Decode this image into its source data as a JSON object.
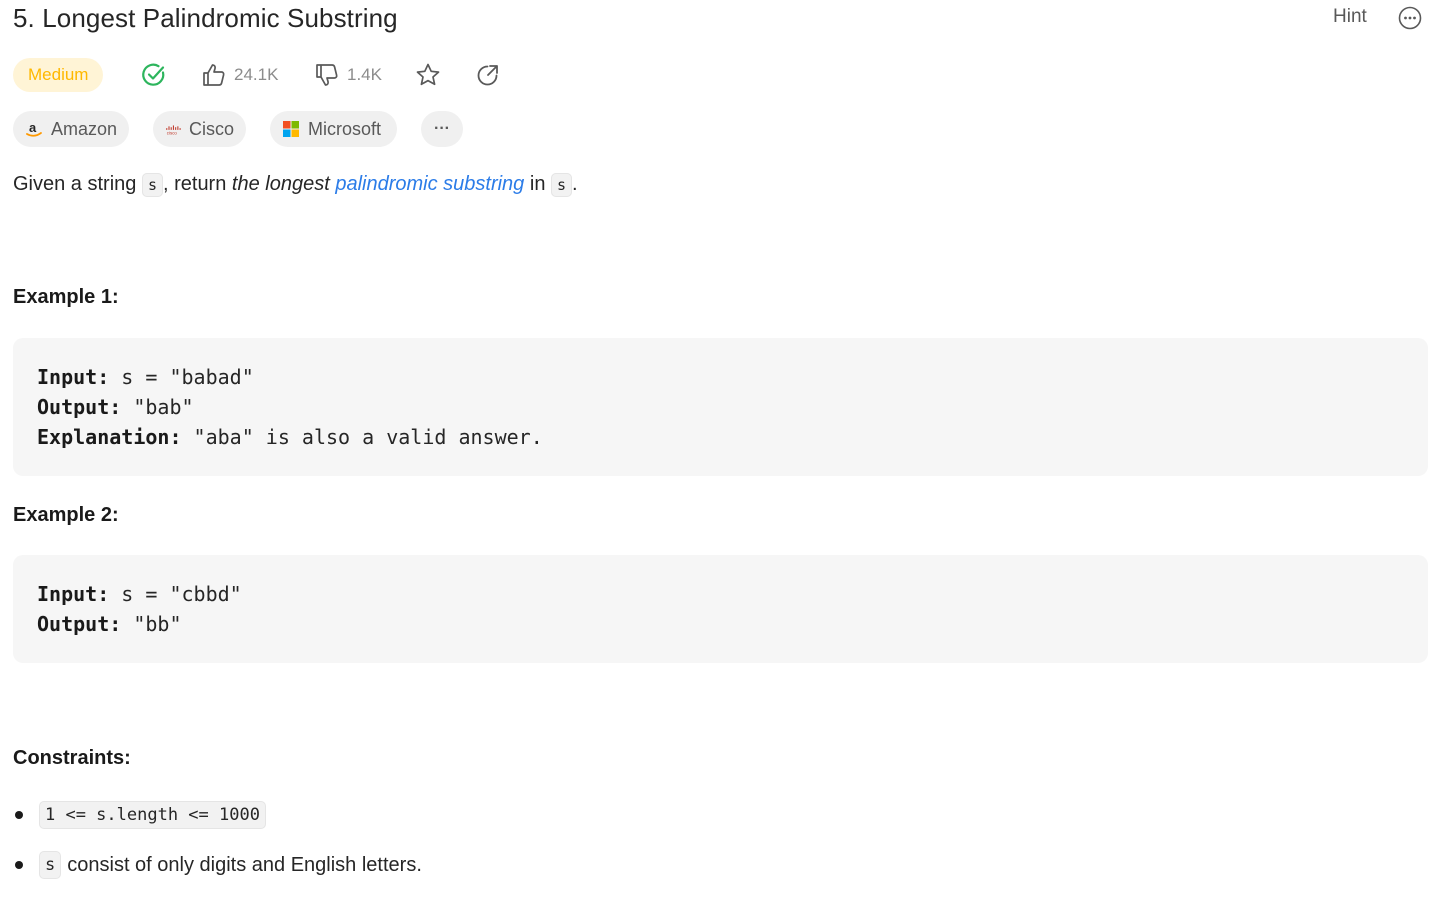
{
  "problem": {
    "title": "5. Longest Palindromic Substring",
    "hint_label": "Hint",
    "difficulty": "Medium",
    "likes": "24.1K",
    "dislikes": "1.4K",
    "colors": {
      "medium_text": "#ffb800",
      "medium_bg": "#fff4d6",
      "solved": "#2db55d",
      "link": "#2b7ce8"
    }
  },
  "tags": [
    {
      "label": "Amazon",
      "icon": "amazon-logo"
    },
    {
      "label": "Cisco",
      "icon": "cisco-logo"
    },
    {
      "label": "Microsoft",
      "icon": "microsoft-logo"
    },
    {
      "label": "···",
      "icon": "more-icon"
    }
  ],
  "description": {
    "part1": "Given a string ",
    "code1": "s",
    "part2": ", return ",
    "italic": "the longest",
    "link": "palindromic substring",
    "part3": " in ",
    "code2": "s",
    "part4": "."
  },
  "examples": [
    {
      "heading": "Example 1:",
      "input_key": "Input:",
      "input_val": " s = \"babad\"",
      "output_key": "Output:",
      "output_val": " \"bab\"",
      "explanation_key": "Explanation:",
      "explanation_val": " \"aba\" is also a valid answer."
    },
    {
      "heading": "Example 2:",
      "input_key": "Input:",
      "input_val": " s = \"cbbd\"",
      "output_key": "Output:",
      "output_val": " \"bb\""
    }
  ],
  "constraints": {
    "heading": "Constraints:",
    "items": [
      {
        "code": "1 <= s.length <= 1000",
        "text": ""
      },
      {
        "code": "s",
        "text": "consist of only digits and English letters."
      }
    ]
  }
}
